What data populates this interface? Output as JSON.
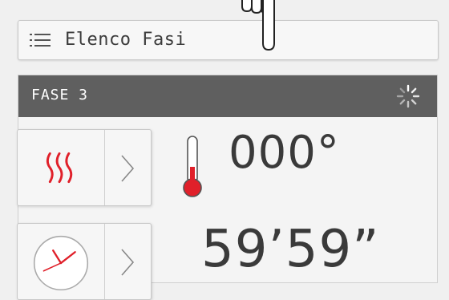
{
  "topbar": {
    "title": "Elenco Fasi",
    "icon": "list-icon"
  },
  "pointer": {
    "icon": "hand-pointer-icon"
  },
  "phase": {
    "title": "FASE 3",
    "status_icon": "loading-spinner-icon"
  },
  "controls": [
    {
      "icon": "heating-icon",
      "arrow_icon": "chevron-right-icon"
    },
    {
      "icon": "clock-icon",
      "arrow_icon": "chevron-right-icon"
    }
  ],
  "temperature": {
    "value": "000°",
    "icon": "thermometer-icon"
  },
  "time": {
    "value": "59’59”"
  },
  "colors": {
    "header_bg": "#5f5f5f",
    "heat_red": "#e0202a",
    "text": "#3a3a3a"
  }
}
